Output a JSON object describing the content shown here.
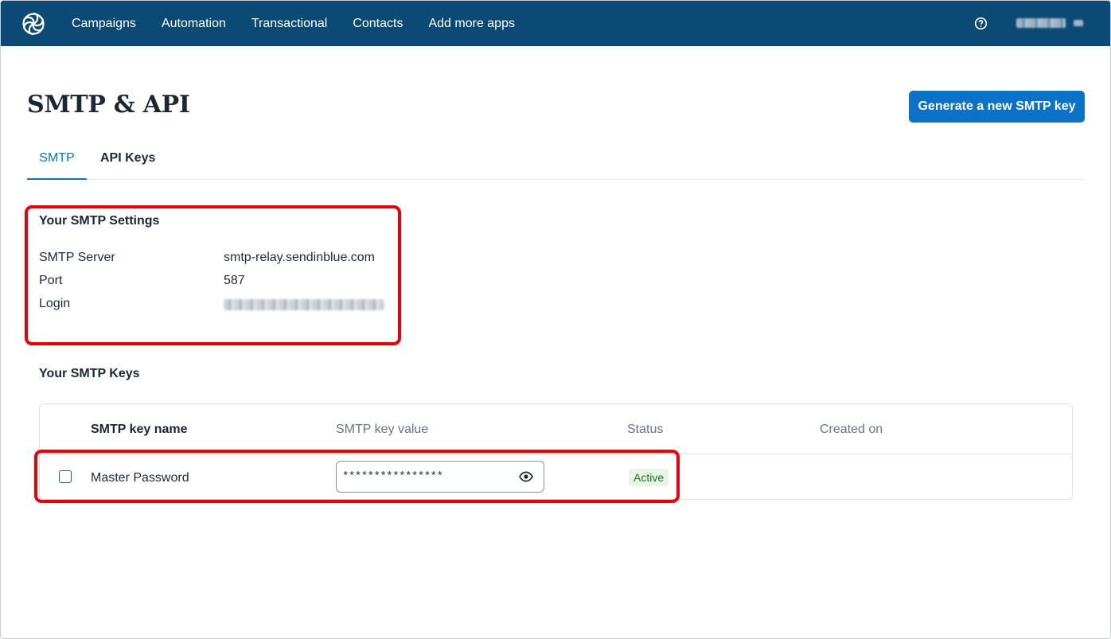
{
  "nav": {
    "items": [
      {
        "label": "Campaigns"
      },
      {
        "label": "Automation"
      },
      {
        "label": "Transactional"
      },
      {
        "label": "Contacts"
      },
      {
        "label": "Add more apps"
      }
    ],
    "help_icon": "help-circle-icon",
    "logo_icon": "sendinblue-swirl-logo"
  },
  "header": {
    "title": "SMTP & API",
    "primary_button": "Generate a new SMTP key"
  },
  "tabs": [
    {
      "label": "SMTP",
      "active": true
    },
    {
      "label": "API Keys",
      "active": false
    }
  ],
  "smtp_settings": {
    "title": "Your SMTP Settings",
    "rows": [
      {
        "key": "SMTP Server",
        "value": "smtp-relay.sendinblue.com"
      },
      {
        "key": "Port",
        "value": "587"
      },
      {
        "key": "Login",
        "value": ""
      }
    ]
  },
  "smtp_keys": {
    "title": "Your SMTP Keys",
    "columns": [
      "SMTP key name",
      "SMTP key value",
      "Status",
      "Created on"
    ],
    "rows": [
      {
        "name": "Master Password",
        "value": "****************",
        "status": "Active",
        "created_on": ""
      }
    ]
  },
  "colors": {
    "nav_bg": "#0b4a75",
    "accent": "#0b72c7",
    "highlight": "#e8000b",
    "badge_bg": "#e6f5e4",
    "badge_text": "#2b6a2a"
  }
}
